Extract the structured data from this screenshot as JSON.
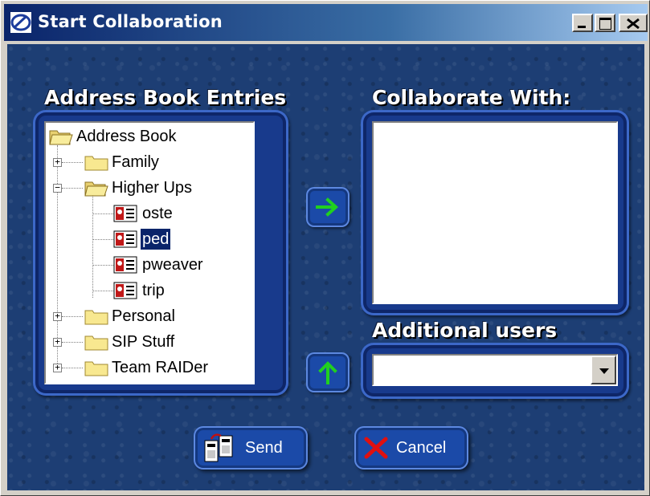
{
  "window": {
    "title": "Start Collaboration",
    "controls": {
      "minimize": "_",
      "maximize": "□",
      "close": "×"
    }
  },
  "address_book": {
    "heading": "Address Book Entries",
    "tree": {
      "root": "Address Book",
      "nodes": [
        {
          "label": "Family",
          "type": "folder",
          "expanded": false
        },
        {
          "label": "Higher Ups",
          "type": "folder",
          "expanded": true,
          "children": [
            {
              "label": "oste",
              "type": "contact"
            },
            {
              "label": "ped",
              "type": "contact",
              "selected": true
            },
            {
              "label": "pweaver",
              "type": "contact"
            },
            {
              "label": "trip",
              "type": "contact"
            }
          ]
        },
        {
          "label": "Personal",
          "type": "folder",
          "expanded": false
        },
        {
          "label": "SIP Stuff",
          "type": "folder",
          "expanded": false
        },
        {
          "label": "Team RAIDer",
          "type": "folder",
          "expanded": false
        }
      ]
    }
  },
  "collaborate": {
    "heading": "Collaborate With:",
    "items": []
  },
  "additional_users": {
    "heading": "Additional users",
    "value": ""
  },
  "buttons": {
    "add_arrow_icon": "arrow-right-icon",
    "add_up_icon": "arrow-up-icon",
    "send_label": "Send",
    "cancel_label": "Cancel"
  },
  "colors": {
    "background": "#1d3e74",
    "frame": "#183a8c",
    "selection": "#0a246a",
    "arrow": "#20d020",
    "cancel_x": "#e01010"
  }
}
